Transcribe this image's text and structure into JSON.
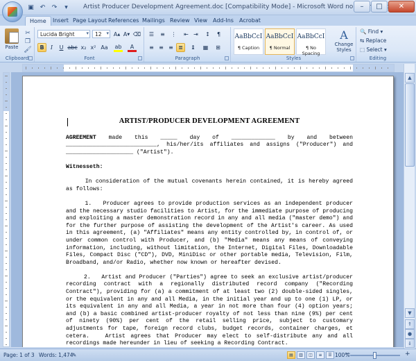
{
  "window": {
    "title": "Artist Producer Development Agreement.doc [Compatibility Mode] - Microsoft Word non-commercial use"
  },
  "quick_access": [
    "save-icon",
    "undo-icon",
    "redo-icon",
    "customize-icon"
  ],
  "tabs": [
    {
      "label": "Home",
      "active": true
    },
    {
      "label": "Insert"
    },
    {
      "label": "Page Layout"
    },
    {
      "label": "References"
    },
    {
      "label": "Mailings"
    },
    {
      "label": "Review"
    },
    {
      "label": "View"
    },
    {
      "label": "Add-Ins"
    },
    {
      "label": "Acrobat"
    }
  ],
  "ribbon": {
    "clipboard": {
      "label": "Clipboard",
      "paste": "Paste"
    },
    "font": {
      "label": "Font",
      "name": "Lucida Bright",
      "size": "12"
    },
    "paragraph": {
      "label": "Paragraph"
    },
    "styles": {
      "label": "Styles",
      "items": [
        {
          "sample": "AaBbCcI",
          "name": "¶ Caption"
        },
        {
          "sample": "AaBbCcI",
          "name": "¶ Normal"
        },
        {
          "sample": "AaBbCcI",
          "name": "¶ No Spacing"
        }
      ],
      "change": "Change Styles"
    },
    "editing": {
      "label": "Editing",
      "find": "Find",
      "replace": "Replace",
      "select": "Select"
    }
  },
  "document": {
    "title": "ARTIST/PRODUCER DEVELOPMENT AGREEMENT",
    "intro_bold": "AGREEMENT",
    "intro_rest": " made this _____ day of _____________ by and between ___________________________, his/her/its affiliates and assigns (\"Producer\") and ____________________ (\"Artist\").",
    "witnesseth": "Witnesseth:",
    "p_consideration": "     In consideration of the mutual covenants herein contained, it is hereby agreed as follows:",
    "p1": "     1.   Producer agrees to provide production services as an independent producer and the necessary studio facilities to Artist, for the immediate purpose of producing and exploiting a master demonstration record in any and all media (\"master demo\") and for the further purpose of assisting the development of the Artist's career. As used in this agreement, (a) \"Affiliates\" means any entity controlled by, in control of, or under common control with Producer, and (b) \"Media\" means any means of conveying information, including, without limitation, the Internet, Digital Files, Downloadable Files, Compact Disc (\"CD\"), DVD, MiniDisc or other portable media, Television, Film, Broadband, and/or Radio, whether now known or hereafter devised.",
    "p2": "     2.   Artist and Producer (\"Parties\") agree to seek an exclusive artist/producer recording contract with a regionally distributed record company (\"Recording Contract\"), providing for (a) a commitment of at least two (2) double-sided singles, or the equivalent in any and all Media, in the initial year and up to one (1) LP, or its equivalent in any and all Media, a year in not more than four (4) option years; and (b) a basic combined artist-producer royalty of not less than nine (9%) per cent of ninety (90%) per cent of the retail selling price, subject to customary adjustments for tape, foreign record clubs, budget records, container charges, et cetera.   Artist agrees that Producer may elect to self-distribute any and all recordings made hereunder in lieu of seeking a Recording Contract."
  },
  "status": {
    "page": "Page: 1 of 3",
    "words": "Words: 1,474",
    "zoom": "100%"
  }
}
